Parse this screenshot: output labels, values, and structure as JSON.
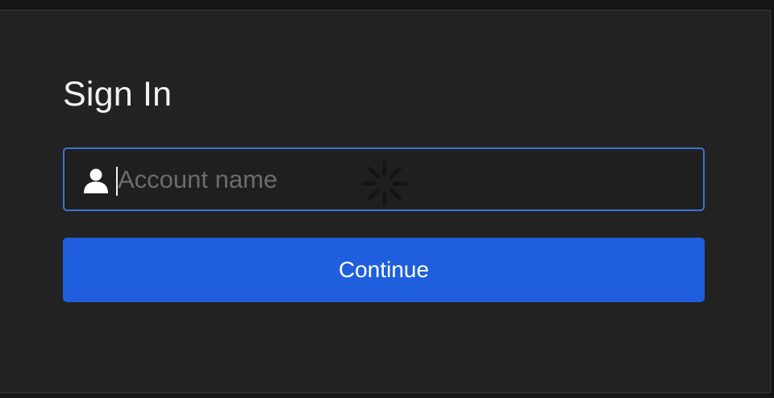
{
  "signin": {
    "title": "Sign In",
    "account_field": {
      "placeholder": "Account name",
      "value": "",
      "icon": "user-icon",
      "focus_color": "#3f72d6"
    },
    "loading_indicator": "spinner-icon",
    "continue_label": "Continue",
    "accent_color": "#1f5fdd"
  }
}
